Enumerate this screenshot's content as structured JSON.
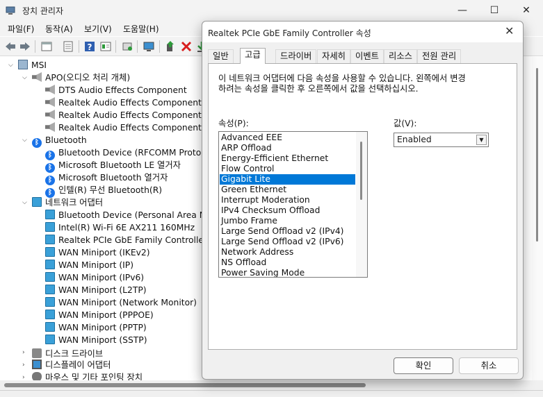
{
  "main_window": {
    "title": "장치 관리자",
    "controls": {
      "minimize": "—",
      "maximize": "☐",
      "close": "✕"
    }
  },
  "menu": [
    "파일(F)",
    "동작(A)",
    "보기(V)",
    "도움말(H)"
  ],
  "toolbar_icons": [
    "back-icon",
    "forward-icon",
    "properties-view-icon",
    "device-view-icon",
    "help-icon",
    "info-icon",
    "scan-hardware-icon",
    "monitor-icon",
    "update-driver-icon",
    "uninstall-icon",
    "download-icon"
  ],
  "tree": {
    "root": "MSI",
    "categories": [
      {
        "label": "APO(오디오 처리 개체)",
        "icon": "speaker-icon",
        "expanded": true,
        "children": [
          "DTS Audio Effects Component",
          "Realtek Audio Effects Component",
          "Realtek Audio Effects Component (INT",
          "Realtek Audio Effects Component (INT"
        ]
      },
      {
        "label": "Bluetooth",
        "icon": "bluetooth-icon",
        "expanded": true,
        "children": [
          "Bluetooth Device (RFCOMM Protocol T",
          "Microsoft Bluetooth LE 열거자",
          "Microsoft Bluetooth 열거자",
          "인텔(R) 무선 Bluetooth(R)"
        ]
      },
      {
        "label": "네트워크 어댑터",
        "icon": "network-icon",
        "expanded": true,
        "children": [
          "Bluetooth Device (Personal Area Netw",
          "Intel(R) Wi-Fi 6E AX211 160MHz",
          "Realtek PCIe GbE Family Controller",
          "WAN Miniport (IKEv2)",
          "WAN Miniport (IP)",
          "WAN Miniport (IPv6)",
          "WAN Miniport (L2TP)",
          "WAN Miniport (Network Monitor)",
          "WAN Miniport (PPPOE)",
          "WAN Miniport (PPTP)",
          "WAN Miniport (SSTP)"
        ]
      },
      {
        "label": "디스크 드라이브",
        "icon": "disk-icon",
        "expanded": false,
        "children": []
      },
      {
        "label": "디스플레이 어댑터",
        "icon": "display-icon",
        "expanded": false,
        "children": []
      },
      {
        "label": "마우스 및 기타 포인팅 장치",
        "icon": "mouse-icon",
        "expanded": false,
        "children": []
      }
    ]
  },
  "dialog": {
    "title": "Realtek PCIe GbE Family Controller 속성",
    "close": "✕",
    "tabs": [
      "일반",
      "고급",
      "드라이버",
      "자세히",
      "이벤트",
      "리소스",
      "전원 관리"
    ],
    "active_tab": 1,
    "description": "이 네트워크 어댑터에 다음 속성을 사용할 수 있습니다. 왼쪽에서 변경\n하려는 속성을 클릭한 후 오른쪽에서 값을 선택하십시오.",
    "property_label": "속성(P):",
    "value_label": "값(V):",
    "properties": [
      "Advanced EEE",
      "ARP Offload",
      "Energy-Efficient Ethernet",
      "Flow Control",
      "Gigabit Lite",
      "Green Ethernet",
      "Interrupt Moderation",
      "IPv4 Checksum Offload",
      "Jumbo Frame",
      "Large Send Offload v2 (IPv4)",
      "Large Send Offload v2 (IPv6)",
      "Network Address",
      "NS Offload",
      "Power Saving Mode"
    ],
    "selected_property_index": 4,
    "value": "Enabled",
    "dropdown_arrow": "▼",
    "ok_label": "확인",
    "cancel_label": "취소"
  }
}
